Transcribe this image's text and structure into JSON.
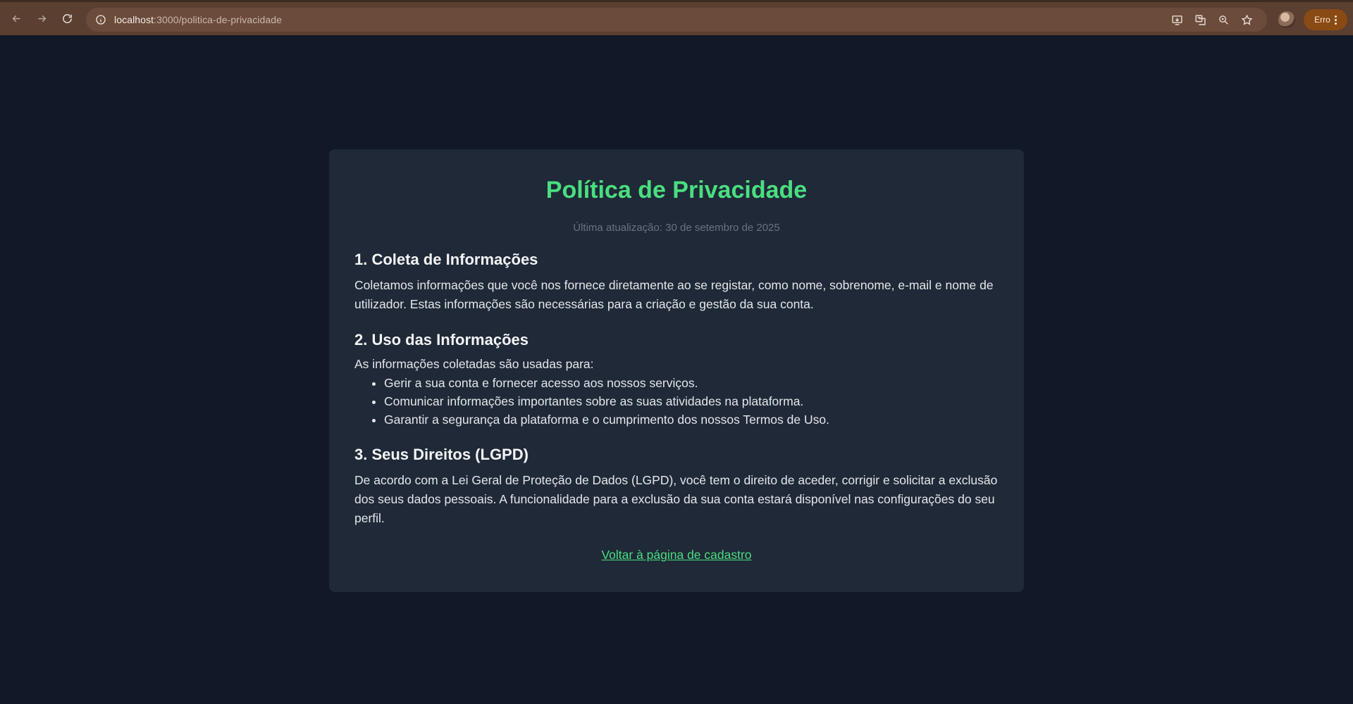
{
  "browser": {
    "url_host": "localhost",
    "url_path": ":3000/politica-de-privacidade",
    "error_label": "Erro",
    "accent": "#5b3f30"
  },
  "page": {
    "title": "Política de Privacidade",
    "updated": "Última atualização: 30 de setembro de 2025",
    "sections": [
      {
        "heading": "1. Coleta de Informações",
        "text": "Coletamos informações que você nos fornece diretamente ao se registar, como nome, sobrenome, e-mail e nome de utilizador. Estas informações são necessárias para a criação e gestão da sua conta."
      },
      {
        "heading": "2. Uso das Informações",
        "text": "As informações coletadas são usadas para:",
        "items": [
          "Gerir a sua conta e fornecer acesso aos nossos serviços.",
          "Comunicar informações importantes sobre as suas atividades na plataforma.",
          "Garantir a segurança da plataforma e o cumprimento dos nossos Termos de Uso."
        ]
      },
      {
        "heading": "3. Seus Direitos (LGPD)",
        "text": "De acordo com a Lei Geral de Proteção de Dados (LGPD), você tem o direito de aceder, corrigir e solicitar a exclusão dos seus dados pessoais. A funcionalidade para a exclusão da sua conta estará disponível nas configurações do seu perfil."
      }
    ],
    "back_link": "Voltar à página de cadastro",
    "accent_color": "#4ade80",
    "background": "#111827",
    "card_color": "#1f2937"
  }
}
